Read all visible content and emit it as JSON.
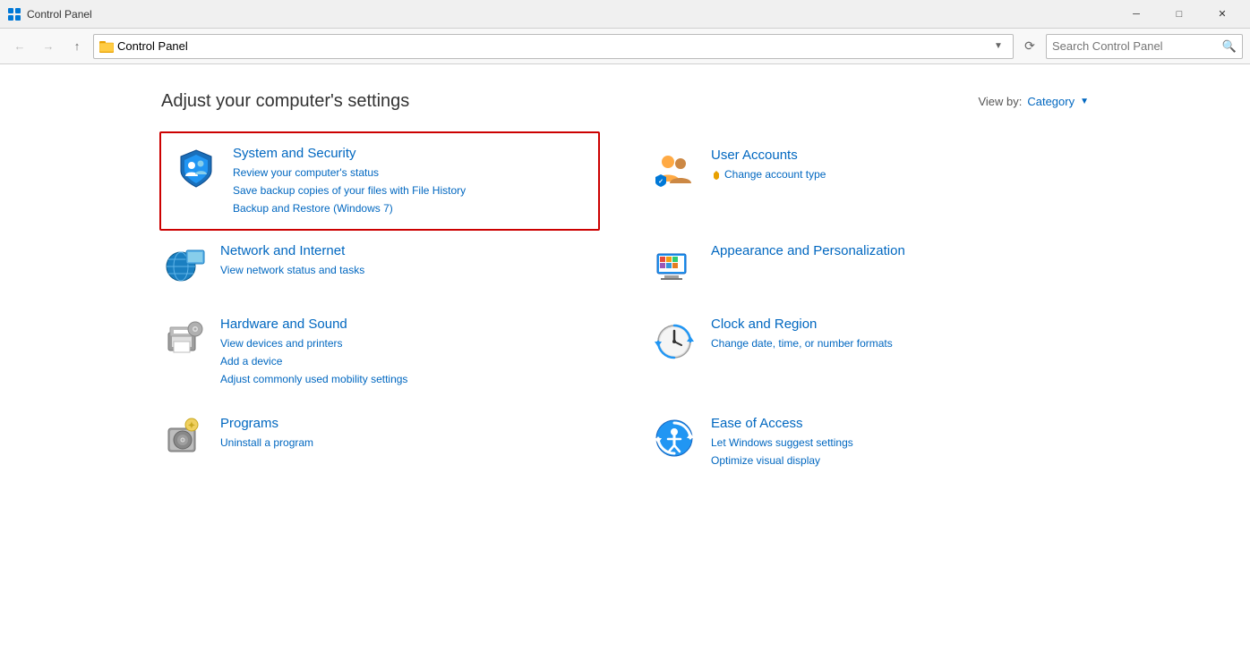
{
  "window": {
    "title": "Control Panel",
    "min_btn": "─",
    "max_btn": "□",
    "close_btn": "✕"
  },
  "nav": {
    "back_disabled": true,
    "forward_disabled": true,
    "up": "↑",
    "address": "Control Panel",
    "refresh": "⟳",
    "search_placeholder": "Search Control Panel"
  },
  "header": {
    "title": "Adjust your computer's settings",
    "view_by_label": "View by:",
    "view_by_value": "Category"
  },
  "categories": [
    {
      "id": "system-security",
      "title": "System and Security",
      "highlighted": true,
      "links": [
        "Review your computer's status",
        "Save backup copies of your files with File History",
        "Backup and Restore (Windows 7)"
      ]
    },
    {
      "id": "user-accounts",
      "title": "User Accounts",
      "highlighted": false,
      "links": [
        "Change account type"
      ]
    },
    {
      "id": "network-internet",
      "title": "Network and Internet",
      "highlighted": false,
      "links": [
        "View network status and tasks"
      ]
    },
    {
      "id": "appearance-personalization",
      "title": "Appearance and Personalization",
      "highlighted": false,
      "links": []
    },
    {
      "id": "hardware-sound",
      "title": "Hardware and Sound",
      "highlighted": false,
      "links": [
        "View devices and printers",
        "Add a device",
        "Adjust commonly used mobility settings"
      ]
    },
    {
      "id": "clock-region",
      "title": "Clock and Region",
      "highlighted": false,
      "links": [
        "Change date, time, or number formats"
      ]
    },
    {
      "id": "programs",
      "title": "Programs",
      "highlighted": false,
      "links": [
        "Uninstall a program"
      ]
    },
    {
      "id": "ease-of-access",
      "title": "Ease of Access",
      "highlighted": false,
      "links": [
        "Let Windows suggest settings",
        "Optimize visual display"
      ]
    }
  ]
}
